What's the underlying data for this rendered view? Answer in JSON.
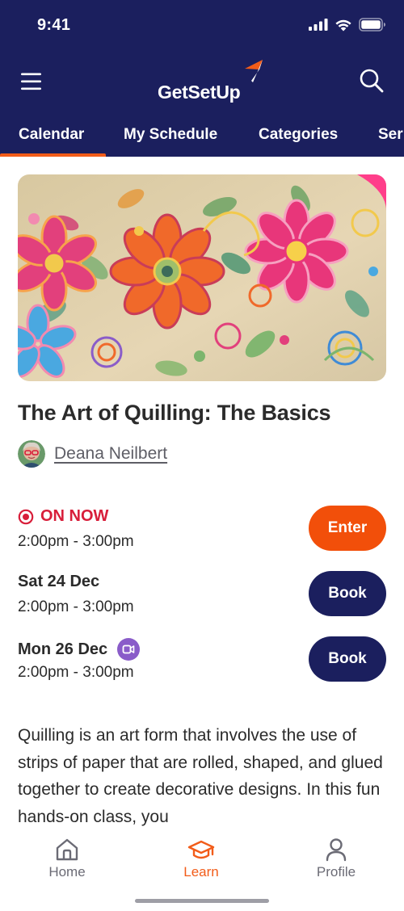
{
  "status_bar": {
    "time": "9:41"
  },
  "brand": {
    "name": "GetSetUp"
  },
  "tabs": [
    {
      "label": "Calendar",
      "active": true
    },
    {
      "label": "My Schedule",
      "active": false
    },
    {
      "label": "Categories",
      "active": false
    },
    {
      "label": "Ser",
      "active": false
    }
  ],
  "class": {
    "title": "The Art of Quilling: The Basics",
    "instructor": "Deana Neilbert"
  },
  "sessions": [
    {
      "label": "ON NOW",
      "time": "2:00pm - 3:00pm",
      "button": "Enter",
      "live": true
    },
    {
      "label": "Sat 24 Dec",
      "time": "2:00pm - 3:00pm",
      "button": "Book"
    },
    {
      "label": "Mon 26 Dec",
      "time": "2:00pm - 3:00pm",
      "button": "Book",
      "video_icon": "video-camera-icon"
    }
  ],
  "description": "Quilling is an art form that involves the use of strips of paper that are rolled, shaped, and glued together to create decorative designs. In this fun hands-on class, you",
  "bottom_nav": [
    {
      "label": "Home",
      "icon": "home-icon",
      "active": false
    },
    {
      "label": "Learn",
      "icon": "graduation-cap-icon",
      "active": true
    },
    {
      "label": "Profile",
      "icon": "person-icon",
      "active": false
    }
  ],
  "colors": {
    "header": "#1b1f5e",
    "accent": "#f25c19",
    "live": "#d81e3a",
    "book_button": "#1b1f5e",
    "video_badge": "#8a5cc9"
  }
}
